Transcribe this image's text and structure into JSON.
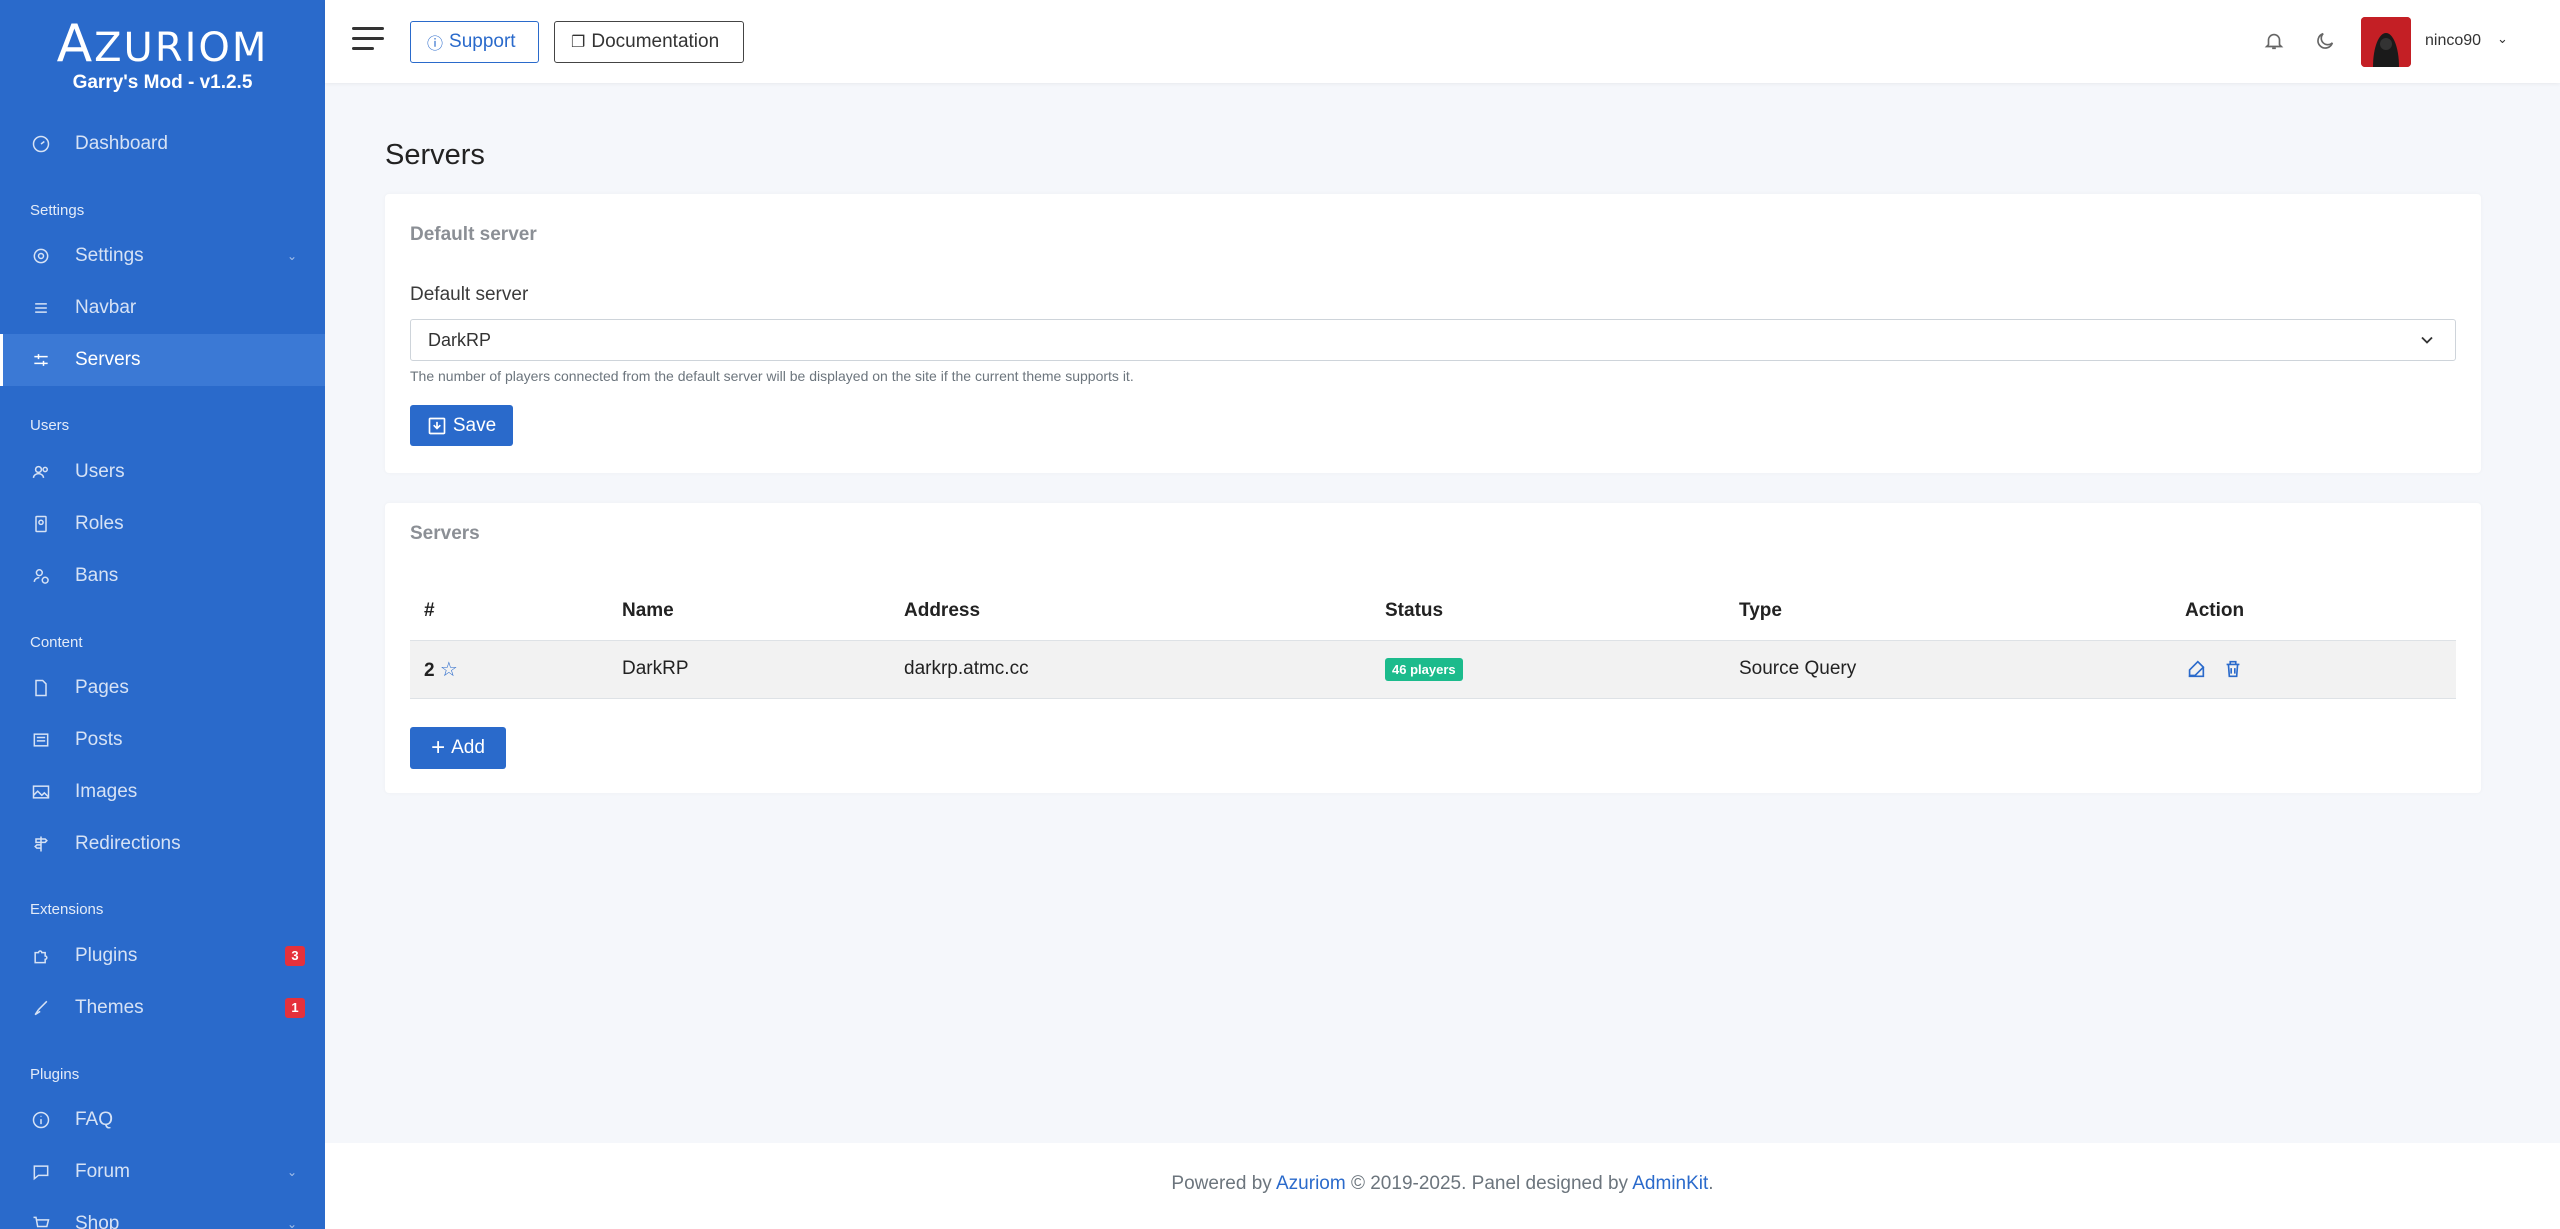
{
  "brand": {
    "logo": "AZURIOM",
    "logo_first": "A",
    "logo_rest": "ZURIOM",
    "subtitle": "Garry's Mod - v1.2.5"
  },
  "sidebar": {
    "dashboard": "Dashboard",
    "settings_header": "Settings",
    "settings": "Settings",
    "navbar": "Navbar",
    "servers": "Servers",
    "users_header": "Users",
    "users": "Users",
    "roles": "Roles",
    "bans": "Bans",
    "content_header": "Content",
    "pages": "Pages",
    "posts": "Posts",
    "images": "Images",
    "redirections": "Redirections",
    "extensions_header": "Extensions",
    "plugins": "Plugins",
    "plugins_badge": "3",
    "themes": "Themes",
    "themes_badge": "1",
    "plugins_header": "Plugins",
    "faq": "FAQ",
    "forum": "Forum",
    "shop": "Shop"
  },
  "topbar": {
    "support": "Support",
    "documentation": "Documentation",
    "username": "ninco90"
  },
  "page": {
    "title": "Servers"
  },
  "default_card": {
    "title": "Default server",
    "label": "Default server",
    "selected": "DarkRP",
    "help": "The number of players connected from the default server will be displayed on the site if the current theme supports it.",
    "save": "Save"
  },
  "servers_card": {
    "title": "Servers",
    "columns": [
      "#",
      "Name",
      "Address",
      "Status",
      "Type",
      "Action"
    ],
    "rows": [
      {
        "id": "2",
        "name": "DarkRP",
        "address": "darkrp.atmc.cc",
        "status": "46 players",
        "type": "Source Query"
      }
    ],
    "add": "Add"
  },
  "footer": {
    "prefix": "Powered by ",
    "azuriom": "Azuriom",
    "middle": " © 2019-2025. Panel designed by ",
    "adminkit": "AdminKit",
    "suffix": "."
  },
  "colors": {
    "primary": "#2a6acb",
    "success": "#1cbb8c",
    "danger": "#e5313b"
  }
}
